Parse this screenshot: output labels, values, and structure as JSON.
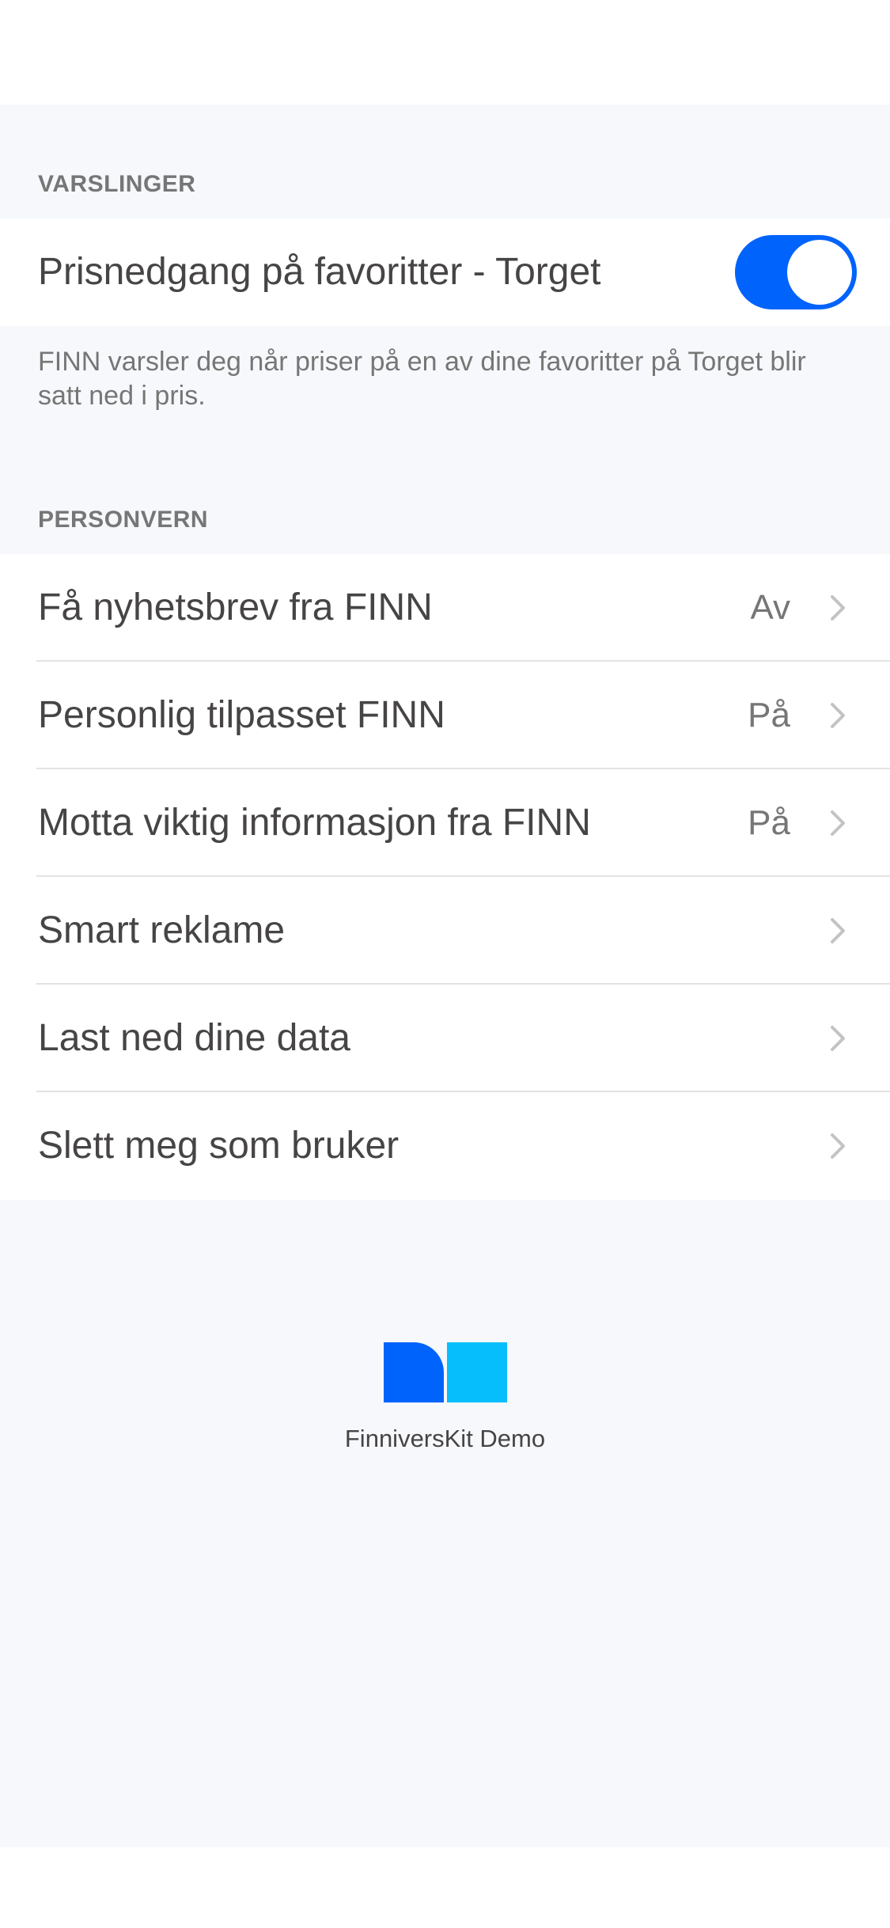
{
  "notifications": {
    "header": "VARSLINGER",
    "toggle_row": {
      "label": "Prisnedgang på favoritter - Torget",
      "enabled": true
    },
    "footer": "FINN varsler deg når priser på en av dine favoritter på Torget blir satt ned i pris."
  },
  "privacy": {
    "header": "PERSONVERN",
    "items": [
      {
        "label": "Få nyhetsbrev fra FINN",
        "value": "Av"
      },
      {
        "label": "Personlig tilpasset FINN",
        "value": "På"
      },
      {
        "label": "Motta viktig informasjon fra FINN",
        "value": "På"
      },
      {
        "label": "Smart reklame",
        "value": ""
      },
      {
        "label": "Last ned dine data",
        "value": ""
      },
      {
        "label": "Slett meg som bruker",
        "value": ""
      }
    ]
  },
  "branding": {
    "app_name": "FinniversKit Demo",
    "logo_colors": {
      "left": "#0063fb",
      "right": "#06befb"
    }
  },
  "colors": {
    "accent": "#0063fb",
    "background": "#f6f8fb",
    "text_primary": "#474445",
    "text_secondary": "#767676"
  }
}
